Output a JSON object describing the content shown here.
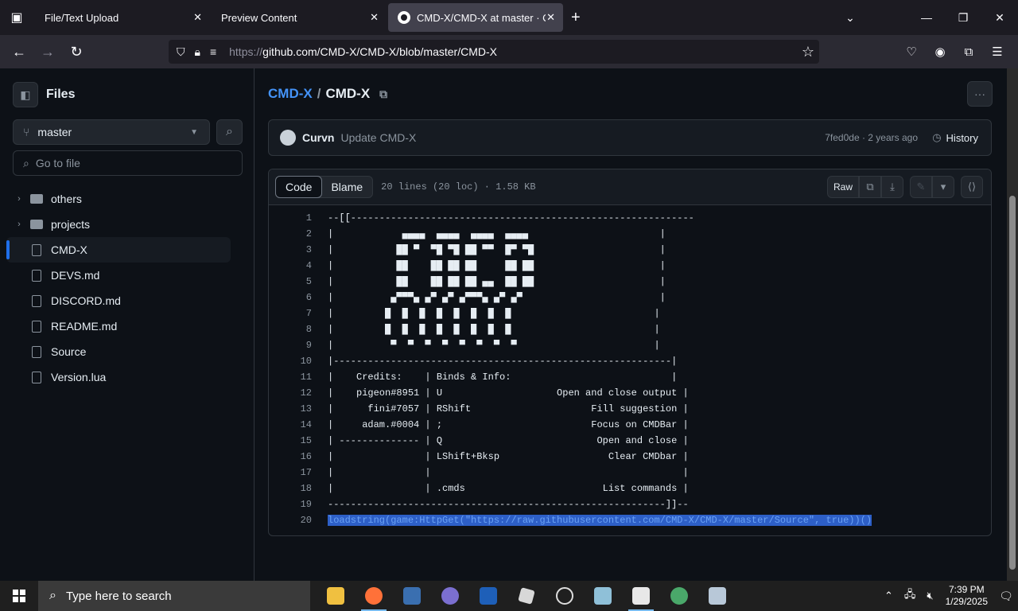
{
  "browser": {
    "tabs": [
      {
        "label": "File/Text Upload"
      },
      {
        "label": "Preview Content"
      },
      {
        "label": "CMD-X/CMD-X at master · CMD"
      }
    ],
    "url_prefix": "https://",
    "url": "github.com/CMD-X/CMD-X/blob/master/CMD-X"
  },
  "sidebar": {
    "title": "Files",
    "branch": "master",
    "goto_placeholder": "Go to file",
    "items": [
      {
        "label": "others",
        "type": "folder"
      },
      {
        "label": "projects",
        "type": "folder"
      },
      {
        "label": "CMD-X",
        "type": "file",
        "selected": true
      },
      {
        "label": "DEVS.md",
        "type": "file"
      },
      {
        "label": "DISCORD.md",
        "type": "file"
      },
      {
        "label": "README.md",
        "type": "file"
      },
      {
        "label": "Source",
        "type": "file"
      },
      {
        "label": "Version.lua",
        "type": "file"
      }
    ]
  },
  "main": {
    "owner": "CMD-X",
    "separator": "/",
    "file": "CMD-X",
    "commit": {
      "author": "Curvn",
      "message": "Update CMD-X",
      "meta": "7fed0de · 2 years ago",
      "history_label": "History"
    },
    "code_tab": "Code",
    "blame_tab": "Blame",
    "file_info": "20 lines (20 loc) · 1.58 KB",
    "raw_label": "Raw",
    "lines": [
      "--[[------------------------------------------------------------",
      "|            ▄▄▄▄  ▄▄▄▄  ▄▄▄▄  ▄▄▄▄                       |",
      "|           ██ ▀  ▀█ ▀█ ██ ▀▀  █▀ ▀█                      |",
      "|           ██    ██ ██ ██     ██ ██                      |",
      "|           ██    ██ ██ ██ ▄▄  ██ ██                      |",
      "|          ▄▀▀▀▄ ▄▀ ▄▀ ▄▀▀▀▄ ▄▀ ▄▀                        |",
      "|         █  █  █  █  █  █  █  █                         |",
      "|         █  █  █  █  █  █  █  █                         |",
      "|          ▀  ▀  ▀  ▀  ▀  ▀  ▀  ▀                        |",
      "|-----------------------------------------------------------|",
      "|    Credits:    | Binds & Info:                            |",
      "|    pigeon#8951 | U                    Open and close output |",
      "|      fini#7057 | RShift                     Fill suggestion |",
      "|     adam.#0004 | ;                          Focus on CMDBar |",
      "| -------------- | Q                           Open and close |",
      "|                | LShift+Bksp                   Clear CMDbar |",
      "|                |                                            |",
      "|                | .cmds                        List commands |",
      "-----------------------------------------------------------]]--",
      "loadstring(game:HttpGet(\"https://raw.githubusercontent.com/CMD-X/CMD-X/master/Source\", true))()"
    ]
  },
  "taskbar": {
    "search_placeholder": "Type here to search",
    "time": "7:39 PM",
    "date": "1/29/2025"
  }
}
